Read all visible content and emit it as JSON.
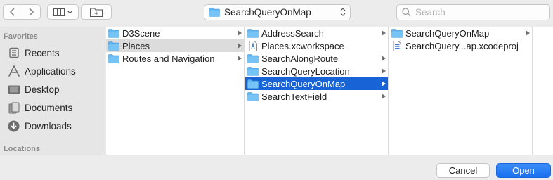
{
  "toolbar": {
    "back_icon": "chevron-left-icon",
    "forward_icon": "chevron-right-icon",
    "view_icon": "column-view-icon",
    "new_folder_icon": "new-folder-icon",
    "location": "SearchQueryOnMap",
    "search_placeholder": "Search"
  },
  "sidebar": {
    "favorites_header": "Favorites",
    "items": [
      {
        "label": "Recents",
        "icon": "clock-icon"
      },
      {
        "label": "Applications",
        "icon": "applications-icon"
      },
      {
        "label": "Desktop",
        "icon": "desktop-icon"
      },
      {
        "label": "Documents",
        "icon": "documents-icon"
      },
      {
        "label": "Downloads",
        "icon": "downloads-icon"
      }
    ],
    "locations_header": "Locations"
  },
  "columns": [
    {
      "rows": [
        {
          "name": "D3Scene",
          "type": "folder",
          "selected": "none",
          "has_children": true
        },
        {
          "name": "Places",
          "type": "folder",
          "selected": "inactive",
          "has_children": true
        },
        {
          "name": "Routes and Navigation",
          "type": "folder",
          "selected": "none",
          "has_children": true
        }
      ]
    },
    {
      "rows": [
        {
          "name": "AddressSearch",
          "type": "folder",
          "selected": "none",
          "has_children": true
        },
        {
          "name": "Places.xcworkspace",
          "type": "workspace",
          "selected": "none",
          "has_children": false
        },
        {
          "name": "SearchAlongRoute",
          "type": "folder",
          "selected": "none",
          "has_children": true
        },
        {
          "name": "SearchQueryLocation",
          "type": "folder",
          "selected": "none",
          "has_children": true
        },
        {
          "name": "SearchQueryOnMap",
          "type": "folder",
          "selected": "active",
          "has_children": true
        },
        {
          "name": "SearchTextField",
          "type": "folder",
          "selected": "none",
          "has_children": true
        }
      ]
    },
    {
      "rows": [
        {
          "name": "SearchQueryOnMap",
          "type": "folder",
          "selected": "none",
          "has_children": true
        },
        {
          "name": "SearchQuery...ap.xcodeproj",
          "type": "xcodeproj",
          "selected": "none",
          "has_children": false
        }
      ]
    }
  ],
  "buttons": {
    "cancel": "Cancel",
    "open": "Open"
  },
  "colors": {
    "selection_blue": "#1863d6",
    "selection_gray": "#dcdcdc",
    "folder_blue": "#5db4ef",
    "primary_button": "#1a6ff0"
  }
}
